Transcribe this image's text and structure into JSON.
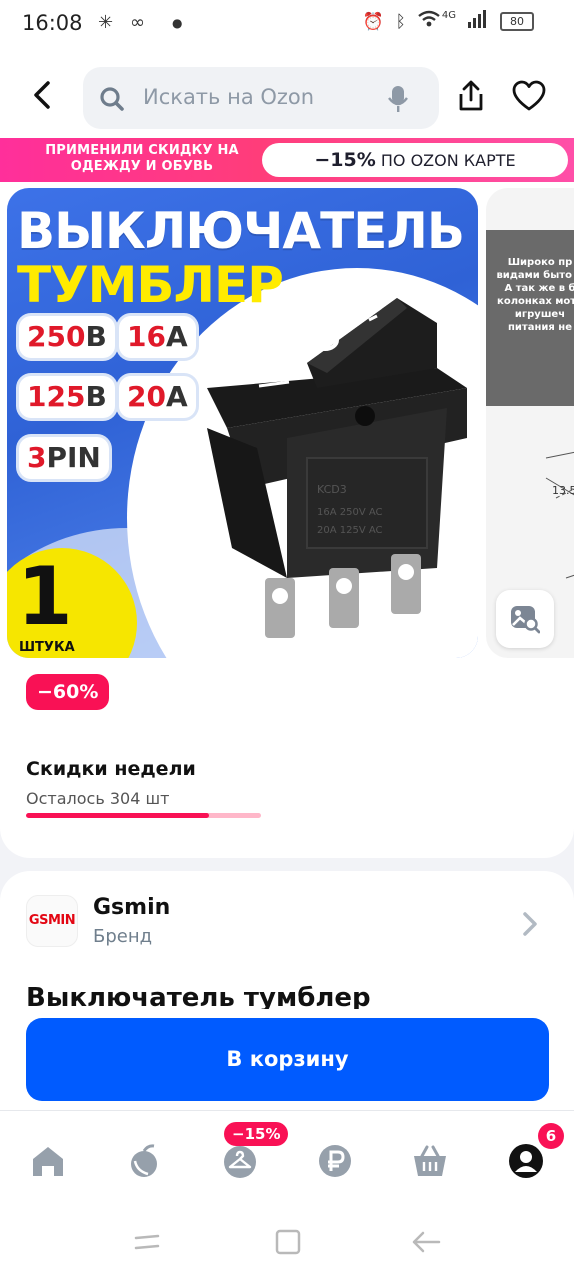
{
  "status_bar": {
    "time": "16:08",
    "battery": "80",
    "network": "4G"
  },
  "header": {
    "search_placeholder": "Искать на Ozon"
  },
  "promo": {
    "left_text": "ПРИМЕНИЛИ СКИДКУ НА ОДЕЖДУ И ОБУВЬ",
    "pill_percent": "−15%",
    "pill_text": "ПО OZON КАРТЕ"
  },
  "gallery": {
    "title_line1": "ВЫКЛЮЧАТЕЛЬ",
    "title_line2": "ТУМБЛЕР",
    "specs": [
      {
        "num": "250",
        "unit": "В"
      },
      {
        "num": "16",
        "unit": "А"
      },
      {
        "num": "125",
        "unit": "В"
      },
      {
        "num": "20",
        "unit": "А"
      },
      {
        "num": "3",
        "unit": "PIN"
      }
    ],
    "qty_number": "1",
    "qty_word": "ШТУКА",
    "side_image_text": "Широко пр видами быто д А так же в б колонках мото игрушеч питания не",
    "side_image_dim": "13.5"
  },
  "product": {
    "discount_badge": "−60%",
    "weekly_label": "Скидки недели",
    "remaining_text": "Осталось 304 шт",
    "remaining_fraction": 0.78,
    "title": "Выключатель тумблер"
  },
  "brand": {
    "logo_text": "GSMIN",
    "name": "Gsmin",
    "label": "Бренд"
  },
  "cart_button": {
    "label": "В корзину"
  },
  "bottom_nav": {
    "items": [
      {
        "icon": "home-icon"
      },
      {
        "icon": "fresh-icon"
      },
      {
        "icon": "fashion-icon",
        "badge": "−15%"
      },
      {
        "icon": "ruble-icon"
      },
      {
        "icon": "cart-icon"
      },
      {
        "icon": "profile-icon",
        "badge": "6"
      }
    ]
  },
  "colors": {
    "accent_blue": "#005bff",
    "promo_pink": "#f91155"
  }
}
